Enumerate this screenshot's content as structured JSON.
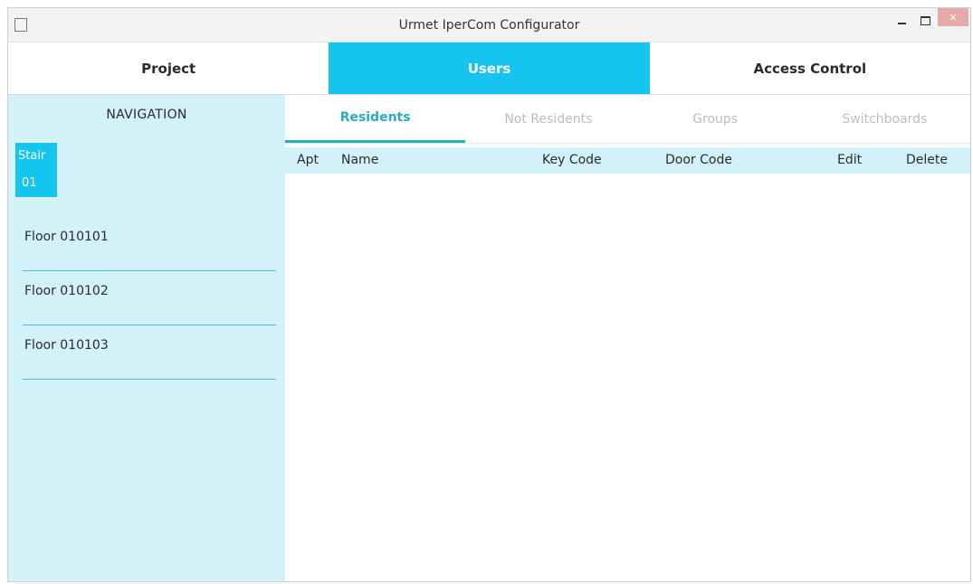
{
  "window": {
    "title": "Urmet IperCom Configurator",
    "controls": {
      "minimize": "–",
      "maximize": "□",
      "close": "×"
    }
  },
  "top_tabs": [
    {
      "label": "Project",
      "active": false
    },
    {
      "label": "Users",
      "active": true
    },
    {
      "label": "Access Control",
      "active": false
    }
  ],
  "navigation": {
    "header": "NAVIGATION",
    "stair": {
      "line1": "Stair",
      "line2": "01"
    },
    "floors": [
      "Floor 010101",
      "Floor 010102",
      "Floor 010103"
    ]
  },
  "sub_tabs": [
    {
      "label": "Residents",
      "active": true
    },
    {
      "label": "Not Residents",
      "active": false
    },
    {
      "label": "Groups",
      "active": false
    },
    {
      "label": "Switchboards",
      "active": false
    }
  ],
  "table": {
    "columns": {
      "apt": "Apt",
      "name": "Name",
      "key_code": "Key Code",
      "door_code": "Door Code",
      "edit": "Edit",
      "delete": "Delete"
    },
    "rows": []
  },
  "colors": {
    "accent": "#15c5ef",
    "nav_background": "#d3f1f9",
    "active_subtab": "#2aa9c0",
    "inactive_subtab": "#bdbdbd"
  }
}
